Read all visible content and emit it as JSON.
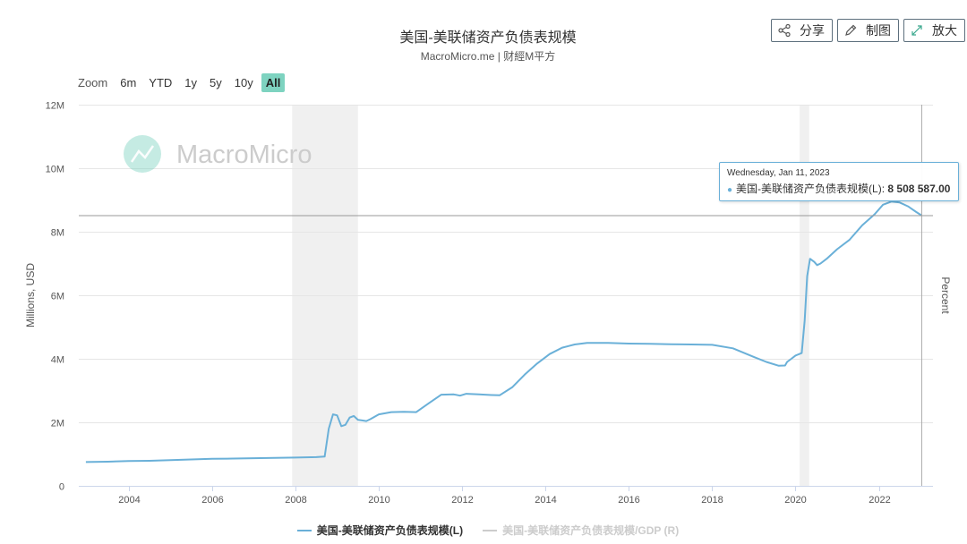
{
  "header": {
    "title": "美国-美联储资产负债表规模",
    "subtitle": "MacroMicro.me | 财經M平方"
  },
  "tools": [
    {
      "label": "分享",
      "icon": "share-icon"
    },
    {
      "label": "制图",
      "icon": "pencil-icon"
    },
    {
      "label": "放大",
      "icon": "expand-icon"
    }
  ],
  "zoom": {
    "label": "Zoom",
    "options": [
      "6m",
      "YTD",
      "1y",
      "5y",
      "10y",
      "All"
    ],
    "active": "All"
  },
  "watermark": "MacroMicro",
  "tooltip": {
    "date": "Wednesday, Jan 11, 2023",
    "series": "美国-美联储资产负债表规模(L)",
    "value": "8 508 587.00"
  },
  "legend": [
    {
      "label": "美国-美联储资产负债表规模(L)",
      "color": "#6ab0d8",
      "active": true
    },
    {
      "label": "美国-美联储资产负债表规模/GDP (R)",
      "color": "#cccccc",
      "active": false
    }
  ],
  "colors": {
    "series": "#6ab0d8",
    "recession_band": "#f0f0f0",
    "zoom_active": "#7ed3c0",
    "watermark": "#7ed3c0"
  },
  "chart_data": {
    "type": "line",
    "title": "美国-美联储资产负债表规模",
    "ylabel": "Millions, USD",
    "y2label": "Percent",
    "ylim": [
      0,
      12000000
    ],
    "yticks": [
      0,
      2000000,
      4000000,
      6000000,
      8000000,
      10000000,
      12000000
    ],
    "ytick_labels": [
      "0",
      "2M",
      "4M",
      "6M",
      "8M",
      "10M",
      "12M"
    ],
    "xlim": [
      2002.8,
      2023.3
    ],
    "xticks": [
      2004,
      2006,
      2008,
      2010,
      2012,
      2014,
      2016,
      2018,
      2020,
      2022
    ],
    "grid": true,
    "legend_position": "bottom-center",
    "recession_bands": [
      [
        2007.92,
        2009.5
      ],
      [
        2020.1,
        2020.33
      ]
    ],
    "crosshair_x": 2023.03,
    "series": [
      {
        "name": "美国-美联储资产负债表规模(L)",
        "x": [
          2002.97,
          2003.5,
          2004.0,
          2004.5,
          2005.0,
          2005.5,
          2006.0,
          2006.5,
          2007.0,
          2007.5,
          2008.0,
          2008.5,
          2008.7,
          2008.8,
          2008.9,
          2009.0,
          2009.1,
          2009.2,
          2009.3,
          2009.4,
          2009.5,
          2009.6,
          2009.7,
          2009.8,
          2010.0,
          2010.3,
          2010.6,
          2010.9,
          2011.2,
          2011.5,
          2011.8,
          2011.95,
          2012.1,
          2012.4,
          2012.7,
          2012.9,
          2013.2,
          2013.5,
          2013.8,
          2014.1,
          2014.4,
          2014.7,
          2015.0,
          2015.5,
          2016.0,
          2016.5,
          2017.0,
          2017.5,
          2018.0,
          2018.5,
          2019.0,
          2019.3,
          2019.6,
          2019.75,
          2019.8,
          2019.9,
          2020.0,
          2020.15,
          2020.22,
          2020.28,
          2020.35,
          2020.45,
          2020.52,
          2020.6,
          2020.75,
          2021.0,
          2021.3,
          2021.6,
          2021.9,
          2022.1,
          2022.3,
          2022.5,
          2022.7,
          2022.9,
          2023.03
        ],
        "values": [
          750000,
          760000,
          780000,
          790000,
          810000,
          830000,
          850000,
          860000,
          870000,
          880000,
          890000,
          905000,
          920000,
          1800000,
          2250000,
          2220000,
          1880000,
          1920000,
          2150000,
          2200000,
          2080000,
          2060000,
          2040000,
          2100000,
          2250000,
          2320000,
          2330000,
          2320000,
          2600000,
          2870000,
          2880000,
          2840000,
          2900000,
          2880000,
          2860000,
          2850000,
          3100000,
          3500000,
          3850000,
          4150000,
          4350000,
          4450000,
          4500000,
          4500000,
          4480000,
          4470000,
          4460000,
          4450000,
          4440000,
          4330000,
          4060000,
          3900000,
          3780000,
          3790000,
          3900000,
          4000000,
          4100000,
          4180000,
          5200000,
          6600000,
          7150000,
          7050000,
          6950000,
          7000000,
          7150000,
          7450000,
          7750000,
          8200000,
          8550000,
          8850000,
          8950000,
          8920000,
          8800000,
          8620000,
          8508587
        ]
      }
    ]
  }
}
